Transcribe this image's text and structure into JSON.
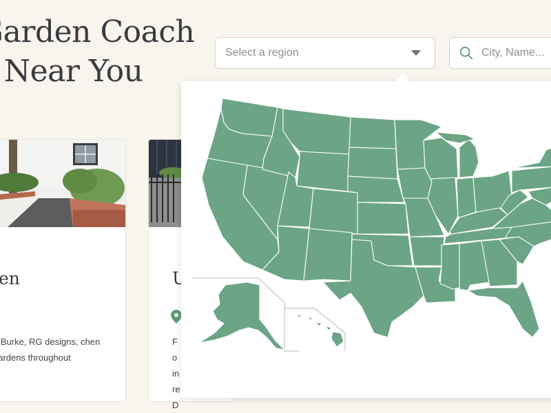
{
  "header": {
    "title_line1": "Garden Coach",
    "title_line2": "s Near You"
  },
  "region_select": {
    "placeholder": "Select a region"
  },
  "search": {
    "placeholder": "City, Name..."
  },
  "cards": [
    {
      "name": "rden",
      "description": "e Burke, RG designs, chen gardens throughout"
    },
    {
      "name": "U",
      "description": "Fo in re D"
    }
  ],
  "colors": {
    "map_fill": "#6ba585",
    "accent": "#5e9a7a",
    "background": "#f8f4ee"
  }
}
